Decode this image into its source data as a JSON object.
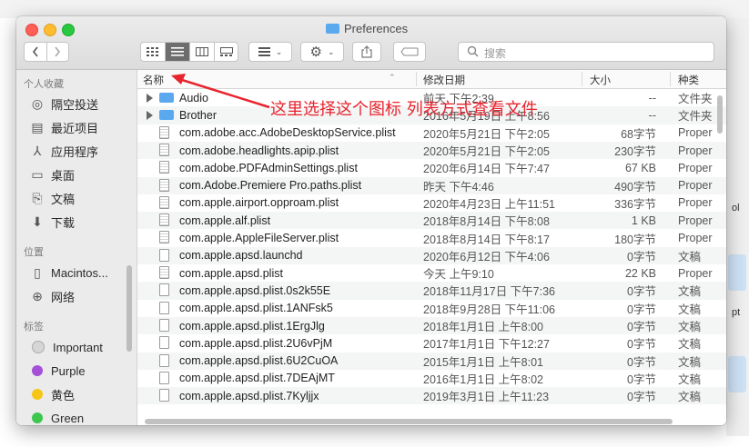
{
  "window": {
    "title": "Preferences"
  },
  "toolbar": {
    "back_icon": "chevron-left-icon",
    "forward_icon": "chevron-right-icon",
    "view_modes": [
      "icon-view-icon",
      "list-view-icon",
      "column-view-icon",
      "gallery-view-icon"
    ],
    "active_view": "list-view-icon",
    "group_icon": "group-icon",
    "action_icon": "gear-icon",
    "share_icon": "share-icon",
    "tag_icon": "tag-icon",
    "search_placeholder": "搜索"
  },
  "sidebar": {
    "favorites_header": "个人收藏",
    "favorites": [
      {
        "label": "隔空投送",
        "icon": "airdrop-icon"
      },
      {
        "label": "最近项目",
        "icon": "recents-icon"
      },
      {
        "label": "应用程序",
        "icon": "applications-icon"
      },
      {
        "label": "桌面",
        "icon": "desktop-icon"
      },
      {
        "label": "文稿",
        "icon": "documents-icon"
      },
      {
        "label": "下载",
        "icon": "downloads-icon"
      }
    ],
    "locations_header": "位置",
    "locations": [
      {
        "label": "Macintos...",
        "icon": "disk-icon"
      },
      {
        "label": "网络",
        "icon": "network-icon"
      }
    ],
    "tags_header": "标签",
    "tags": [
      {
        "label": "Important",
        "color": "#d6d6d6"
      },
      {
        "label": "Purple",
        "color": "#a550d8"
      },
      {
        "label": "黄色",
        "color": "#f5c518"
      },
      {
        "label": "Green",
        "color": "#3cc64e"
      }
    ]
  },
  "columns": {
    "name": "名称",
    "date": "修改日期",
    "size": "大小",
    "kind": "种类"
  },
  "files": [
    {
      "name": "Audio",
      "date": "前天 下午2:39",
      "size": "--",
      "kind": "文件夹",
      "type": "folder"
    },
    {
      "name": "Brother",
      "date": "2016年5月19日 上午8:56",
      "size": "--",
      "kind": "文件夹",
      "type": "folder"
    },
    {
      "name": "com.adobe.acc.AdobeDesktopService.plist",
      "date": "2020年5月21日 下午2:05",
      "size": "68字节",
      "kind": "Proper",
      "type": "plist"
    },
    {
      "name": "com.adobe.headlights.apip.plist",
      "date": "2020年5月21日 下午2:05",
      "size": "230字节",
      "kind": "Proper",
      "type": "plist"
    },
    {
      "name": "com.adobe.PDFAdminSettings.plist",
      "date": "2020年6月14日 下午7:47",
      "size": "67 KB",
      "kind": "Proper",
      "type": "plist"
    },
    {
      "name": "com.Adobe.Premiere Pro.paths.plist",
      "date": "昨天 下午4:46",
      "size": "490字节",
      "kind": "Proper",
      "type": "plist"
    },
    {
      "name": "com.apple.airport.opproam.plist",
      "date": "2020年4月23日 上午11:51",
      "size": "336字节",
      "kind": "Proper",
      "type": "plist"
    },
    {
      "name": "com.apple.alf.plist",
      "date": "2018年8月14日 下午8:08",
      "size": "1 KB",
      "kind": "Proper",
      "type": "plist"
    },
    {
      "name": "com.apple.AppleFileServer.plist",
      "date": "2018年8月14日 下午8:17",
      "size": "180字节",
      "kind": "Proper",
      "type": "plist"
    },
    {
      "name": "com.apple.apsd.launchd",
      "date": "2020年6月12日 下午4:06",
      "size": "0字节",
      "kind": "文稿",
      "type": "doc"
    },
    {
      "name": "com.apple.apsd.plist",
      "date": "今天 上午9:10",
      "size": "22 KB",
      "kind": "Proper",
      "type": "plist"
    },
    {
      "name": "com.apple.apsd.plist.0s2k55E",
      "date": "2018年11月17日 下午7:36",
      "size": "0字节",
      "kind": "文稿",
      "type": "doc"
    },
    {
      "name": "com.apple.apsd.plist.1ANFsk5",
      "date": "2018年9月28日 下午11:06",
      "size": "0字节",
      "kind": "文稿",
      "type": "doc"
    },
    {
      "name": "com.apple.apsd.plist.1ErgJlg",
      "date": "2018年1月1日 上午8:00",
      "size": "0字节",
      "kind": "文稿",
      "type": "doc"
    },
    {
      "name": "com.apple.apsd.plist.2U6vPjM",
      "date": "2017年1月1日 下午12:27",
      "size": "0字节",
      "kind": "文稿",
      "type": "doc"
    },
    {
      "name": "com.apple.apsd.plist.6U2CuOA",
      "date": "2015年1月1日 上午8:01",
      "size": "0字节",
      "kind": "文稿",
      "type": "doc"
    },
    {
      "name": "com.apple.apsd.plist.7DEAjMT",
      "date": "2016年1月1日 上午8:02",
      "size": "0字节",
      "kind": "文稿",
      "type": "doc"
    },
    {
      "name": "com.apple.apsd.plist.7Kyljjx",
      "date": "2019年3月1日 上午11:23",
      "size": "0字节",
      "kind": "文稿",
      "type": "doc"
    }
  ],
  "annotation": {
    "text": "这里选择这个图标 列表方式查看文件",
    "color": "#e8242e"
  },
  "background_hints": [
    {
      "text": "ol"
    },
    {
      "text": "pt"
    }
  ]
}
